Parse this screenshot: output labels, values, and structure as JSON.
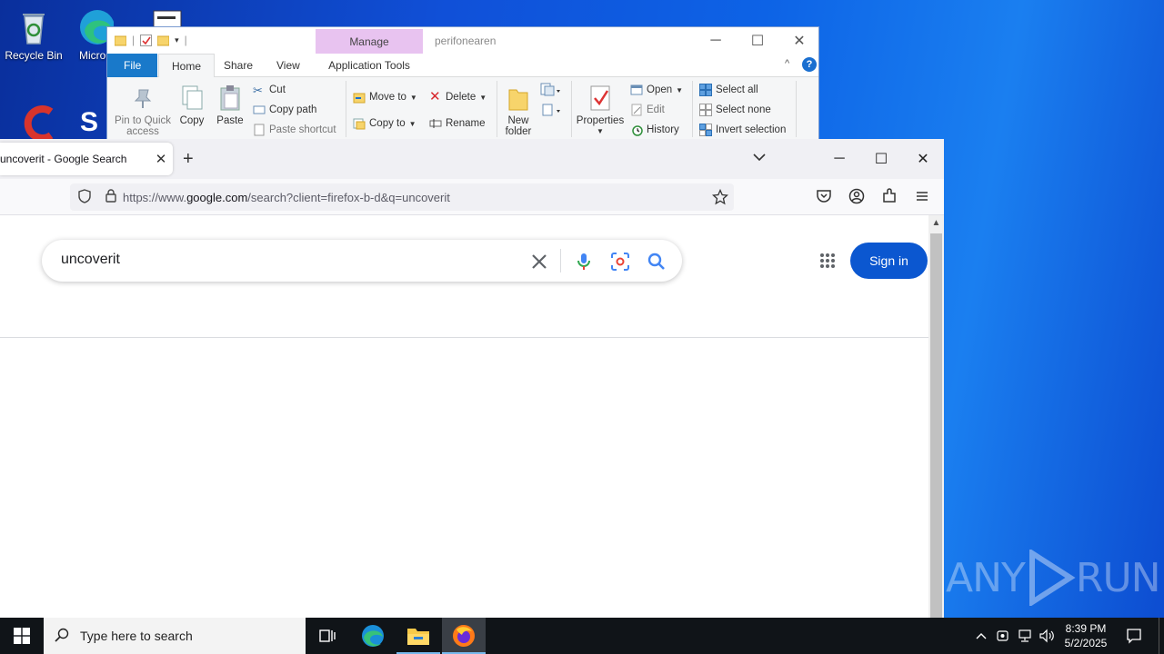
{
  "desktop": {
    "icons": [
      {
        "label": "Recycle Bin"
      },
      {
        "label": "Micro Edg"
      },
      {
        "label": ""
      }
    ]
  },
  "explorer": {
    "title": "perifonearen",
    "manage_tab": "Manage",
    "tabs": [
      "File",
      "Home",
      "Share",
      "View",
      "Application Tools"
    ],
    "clipboard": {
      "pin": "Pin to Quick access",
      "copy": "Copy",
      "paste": "Paste",
      "cut": "Cut",
      "copy_path": "Copy path",
      "paste_shortcut": "Paste shortcut"
    },
    "organize": {
      "move_to": "Move to",
      "copy_to": "Copy to",
      "delete": "Delete",
      "rename": "Rename"
    },
    "new": {
      "new_folder": "New folder"
    },
    "open": {
      "properties": "Properties",
      "open": "Open",
      "edit": "Edit",
      "history": "History"
    },
    "select": {
      "select_all": "Select all",
      "select_none": "Select none",
      "invert": "Invert selection"
    }
  },
  "firefox": {
    "tab_title": "uncoverit - Google Search",
    "url_prefix": "https://www.",
    "url_domain": "google.com",
    "url_path": "/search?client=firefox-b-d&q=uncoverit",
    "search_query": "uncoverit",
    "sign_in": "Sign in"
  },
  "taskbar": {
    "search_placeholder": "Type here to search",
    "time": "8:39 PM",
    "date": "5/2/2025"
  },
  "watermark": {
    "left": "ANY",
    "right": "RUN"
  },
  "colors": {
    "google_blue": "#0b57d0",
    "explorer_file_tab": "#1979ca",
    "manage_tab": "#e8c3f0"
  }
}
